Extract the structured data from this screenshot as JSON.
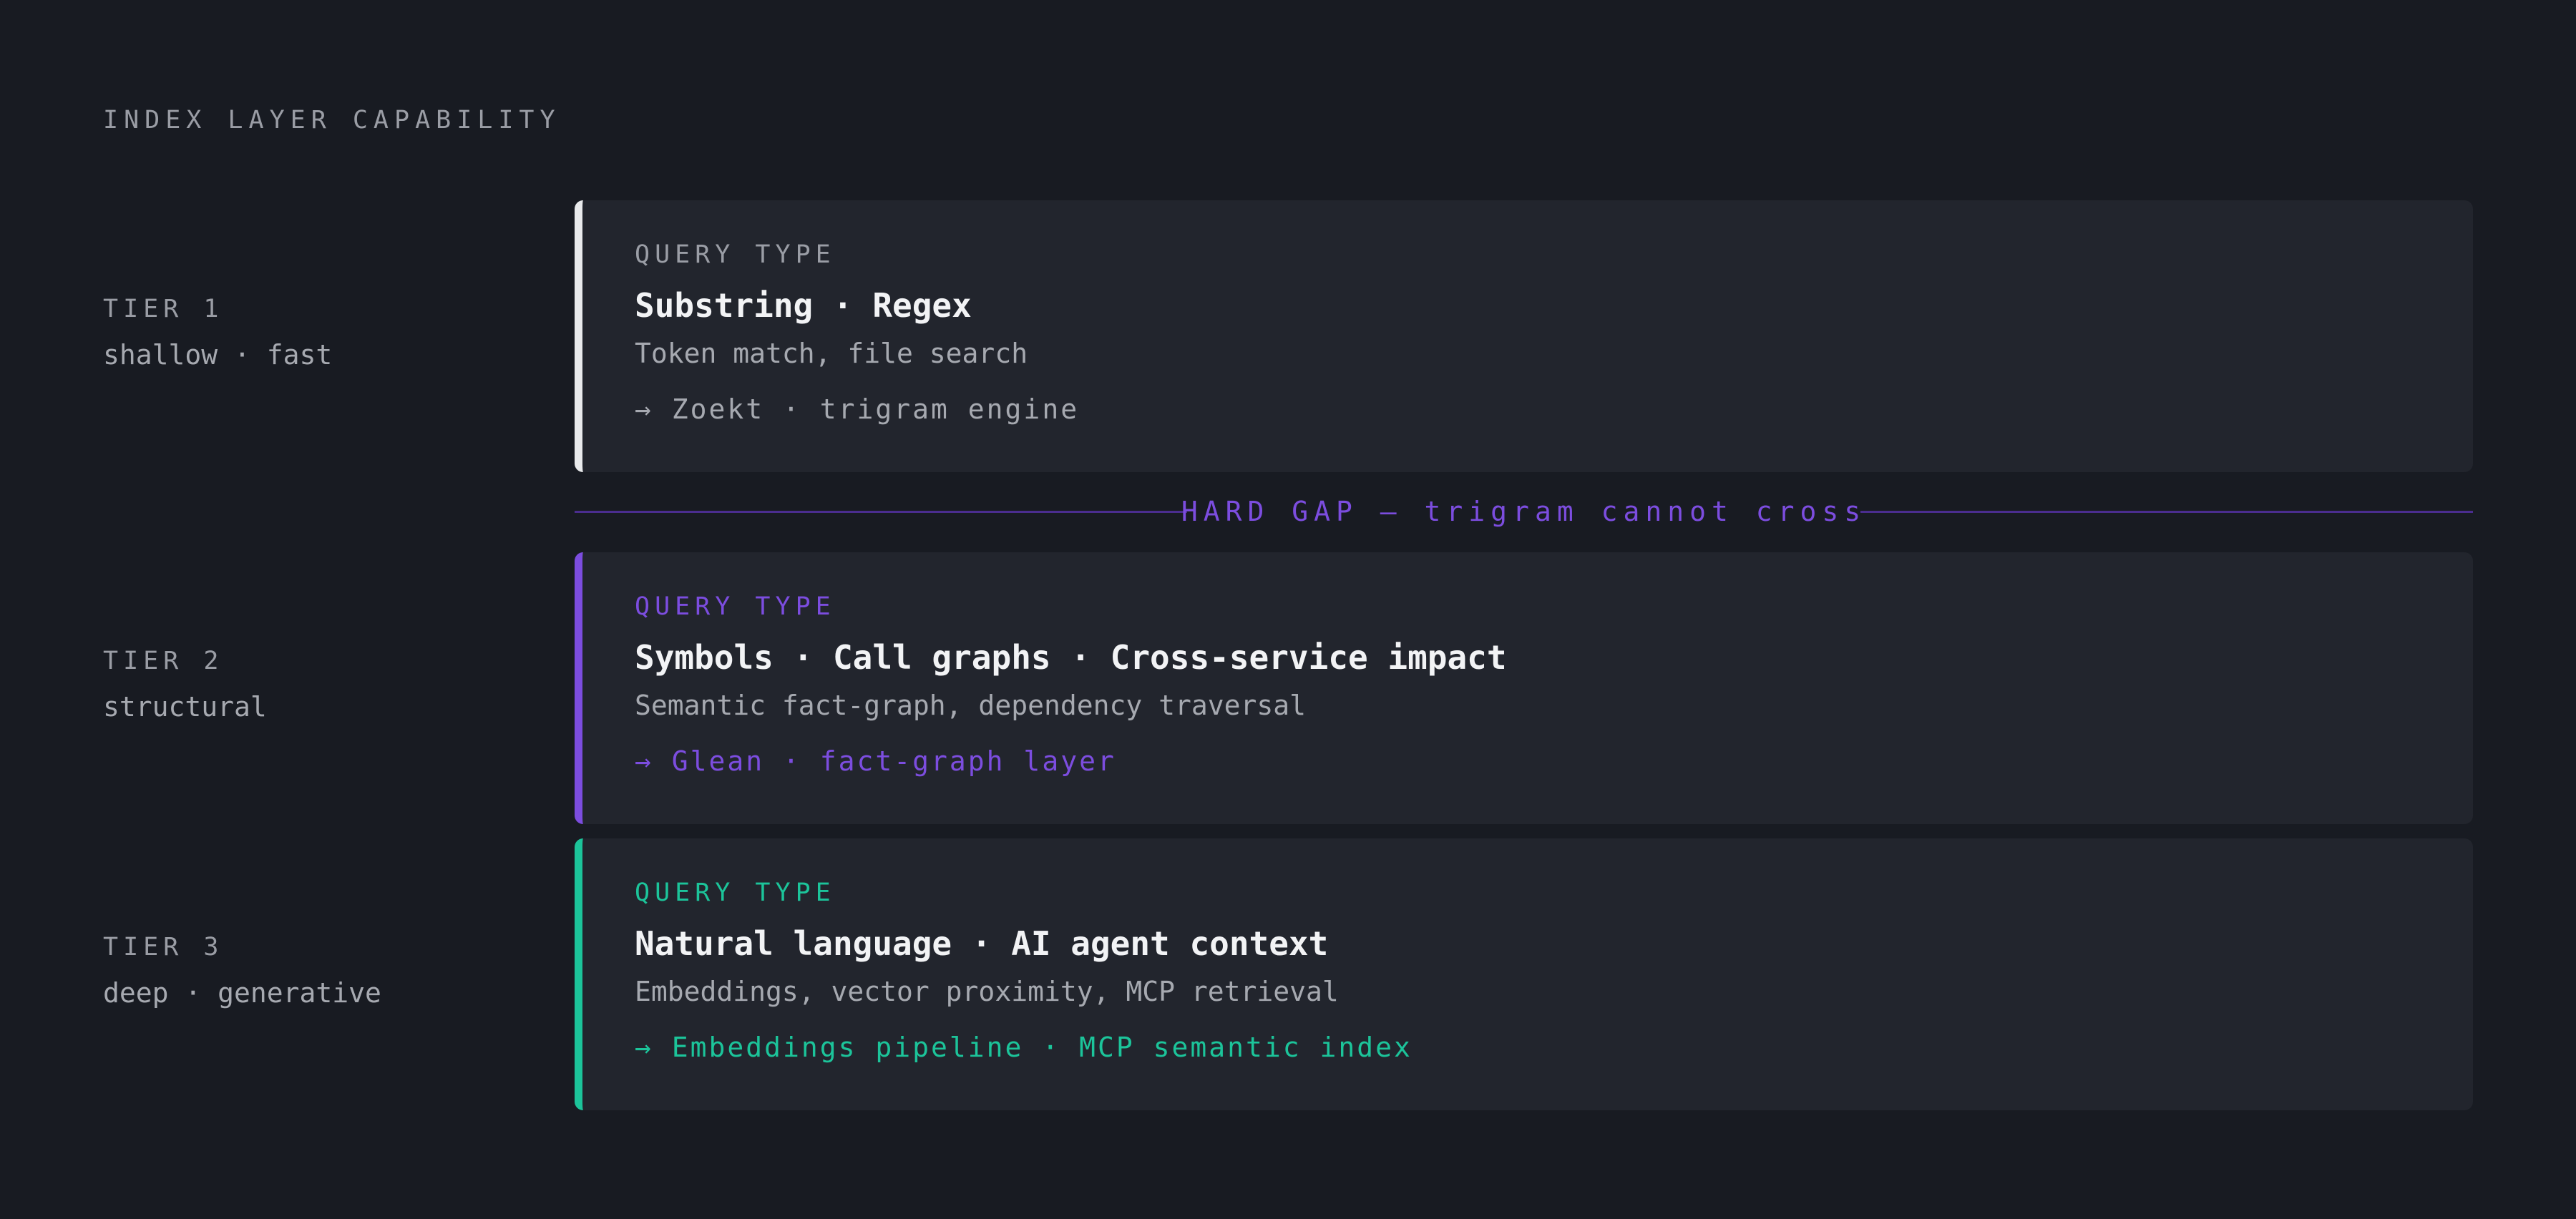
{
  "title": "INDEX LAYER CAPABILITY",
  "colors": {
    "background": "#181b22",
    "card": "#22252d",
    "tier1_accent": "#e9eaec",
    "tier2_accent": "#7c4ddf",
    "tier3_accent": "#1cc49a"
  },
  "tiers": [
    {
      "name": "TIER 1",
      "desc": "shallow · fast",
      "query_label": "QUERY TYPE",
      "query_title": "Substring · Regex",
      "query_desc": "Token match, file search",
      "engine": "→ Zoekt · trigram engine"
    },
    {
      "name": "TIER 2",
      "desc": "structural",
      "query_label": "QUERY TYPE",
      "query_title": "Symbols · Call graphs · Cross-service impact",
      "query_desc": "Semantic fact-graph, dependency traversal",
      "engine": "→ Glean · fact-graph layer"
    },
    {
      "name": "TIER 3",
      "desc": "deep · generative",
      "query_label": "QUERY TYPE",
      "query_title": "Natural language · AI agent context",
      "query_desc": "Embeddings, vector proximity, MCP retrieval",
      "engine": "→ Embeddings pipeline · MCP semantic index"
    }
  ],
  "gap": {
    "label": "HARD GAP — trigram cannot cross"
  }
}
